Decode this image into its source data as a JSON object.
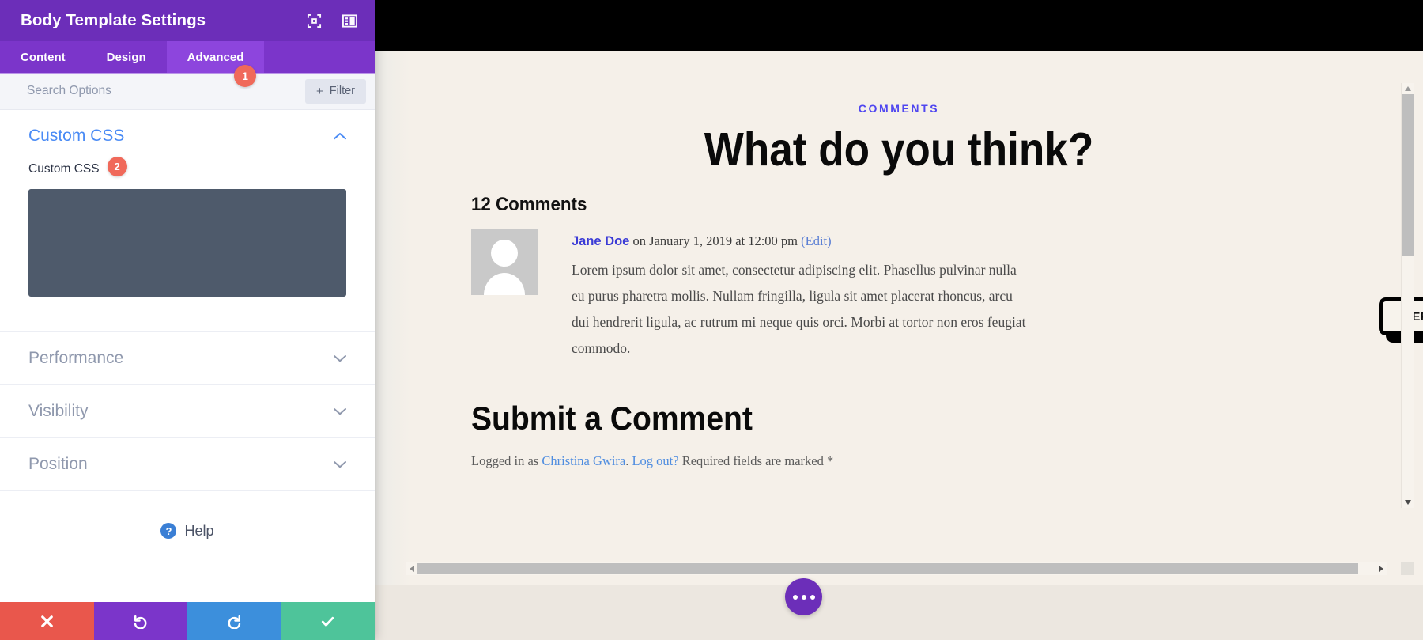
{
  "panel": {
    "title": "Body Template Settings",
    "header_icons": [
      {
        "name": "focus-fullscreen-icon"
      },
      {
        "name": "panel-layout-icon"
      }
    ],
    "tabs": [
      {
        "label": "Content",
        "active": false
      },
      {
        "label": "Design",
        "active": false
      },
      {
        "label": "Advanced",
        "active": true
      }
    ],
    "badges": {
      "tab_marker": "1",
      "field_marker": "2"
    },
    "search": {
      "placeholder": "Search Options",
      "value": ""
    },
    "filter_button": {
      "label": "Filter",
      "plus": "+"
    },
    "sections": [
      {
        "title": "Custom CSS",
        "open": true
      },
      {
        "title": "Performance",
        "open": false
      },
      {
        "title": "Visibility",
        "open": false
      },
      {
        "title": "Position",
        "open": false
      }
    ],
    "custom_css_field": {
      "label": "Custom CSS",
      "value": ""
    },
    "help": {
      "label": "Help",
      "icon_glyph": "?"
    },
    "footer": [
      {
        "name": "cancel-button",
        "icon": "close-icon",
        "color": "#e9574c"
      },
      {
        "name": "undo-button",
        "icon": "undo-icon",
        "color": "#7b35ca"
      },
      {
        "name": "redo-button",
        "icon": "redo-icon",
        "color": "#3c8fdc"
      },
      {
        "name": "save-button",
        "icon": "check-icon",
        "color": "#4ec49a"
      }
    ]
  },
  "preview": {
    "eyebrow": "COMMENTS",
    "heading": "What do you think?",
    "comments_count": "12 Comments",
    "comment": {
      "author": "Jane Doe",
      "date": " on January 1, 2019 at 12:00 pm ",
      "edit": "(Edit)",
      "body": "Lorem ipsum dolor sit amet, consectetur adipiscing elit. Phasellus pulvinar nulla eu purus pharetra mollis. Nullam fringilla, ligula sit amet placerat rhoncus, arcu dui hendrerit ligula, ac rutrum mi neque quis orci. Morbi at tortor non eros feugiat commodo."
    },
    "reply_button": "REPLY",
    "submit_title": "Submit a Comment",
    "logged_in": {
      "prefix": "Logged in as ",
      "user": "Christina Gwira",
      "separator": ". ",
      "logout": "Log out?",
      "suffix": " Required fields are marked *"
    },
    "fab": {
      "name": "more-options-fab"
    }
  },
  "colors": {
    "brand_purple": "#6c2eb9",
    "tab_purple": "#7b35ca",
    "tab_active": "#8d45dd",
    "badge_red": "#f0695a",
    "link_blue": "#4a8bf5",
    "canvas_bg": "#f5f0e9",
    "eyebrow_blue": "#4f46f0",
    "css_box": "#4e5a6b"
  }
}
